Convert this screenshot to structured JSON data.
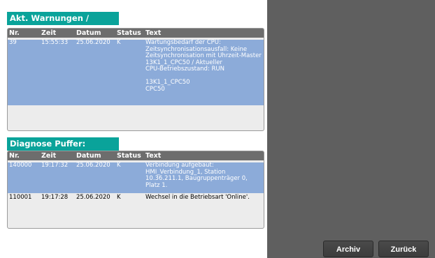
{
  "warnings": {
    "title": "Akt. Warnungen / Fehler",
    "columns": [
      "Nr.",
      "Zeit",
      "Datum",
      "Status",
      "Text"
    ],
    "rows": [
      {
        "nr": "39",
        "zeit": "15:55:33",
        "datum": "25.06.2020",
        "status": "K",
        "text": "Wartungsbedarf der CPU:\nZeitsynchronisationsausfall: Keine\nZeitsynchronisation mit Uhrzeit-Master\n 13K1_1_CPC50 / Aktueller\nCPU-Betriebszustand: RUN\n\n 13K1_1_CPC50\nCPC50",
        "selected": true
      }
    ]
  },
  "diagnose": {
    "title": "Diagnose Puffer:",
    "columns": [
      "Nr.",
      "Zeit",
      "Datum",
      "Status",
      "Text"
    ],
    "rows": [
      {
        "nr": "140000",
        "zeit": "19:17:32",
        "datum": "25.06.2020",
        "status": "K",
        "text": "Verbindung aufgebaut:\nHMI_Verbindung_1, Station\n10.36.211.1, Baugruppenträger 0,\nPlatz 1.",
        "selected": true
      },
      {
        "nr": "110001",
        "zeit": "19:17:28",
        "datum": "25.06.2020",
        "status": "K",
        "text": "Wechsel in die Betriebsart 'Online'.",
        "selected": false
      }
    ]
  },
  "buttons": {
    "archiv": "Archiv",
    "zurueck": "Zurück"
  },
  "colors": {
    "section_header": "#0aa39a",
    "selected_row": "#8cabd9",
    "column_header": "#6d6d6d",
    "background": "#5f5f5f"
  }
}
